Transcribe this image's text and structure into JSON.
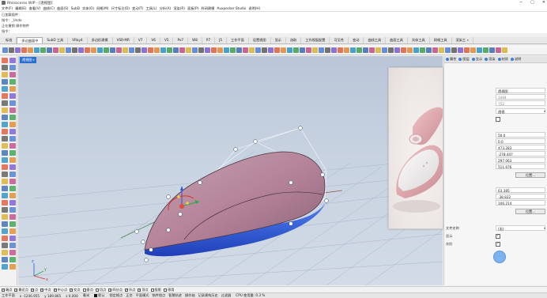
{
  "window": {
    "title": "Rhinoceros WIP - [透视图]",
    "min_label": "−",
    "max_label": "▢",
    "close_label": "✕"
  },
  "menu": [
    "文件(F)",
    "编辑(E)",
    "查看(V)",
    "曲线(C)",
    "曲面(S)",
    "SubD",
    "实体(O)",
    "网格(M)",
    "尺寸标注(D)",
    "变动(T)",
    "工具(L)",
    "分析(A)",
    "渲染(R)",
    "面板(P)",
    "科研建模",
    "Auxpecker Studio",
    "说明(H)"
  ],
  "command_history": [
    "已加载插件：",
    "指令：_Undo",
    "正在撤销 操作物件",
    "指令："
  ],
  "tabs": [
    {
      "label": "标准",
      "active": false
    },
    {
      "label": "多边曲面中",
      "active": true
    },
    {
      "label": "SubD 工具",
      "active": false
    },
    {
      "label": "VRay4",
      "active": false
    },
    {
      "label": "多边形建模",
      "active": false
    },
    {
      "label": "VSR-MR",
      "active": false
    },
    {
      "label": "V7",
      "active": false
    },
    {
      "label": "V6",
      "active": false
    },
    {
      "label": "V5",
      "active": false
    },
    {
      "label": "Pe7",
      "active": false
    },
    {
      "label": "W8",
      "active": false
    },
    {
      "label": "P7",
      "active": false
    },
    {
      "label": "J5",
      "active": false
    },
    {
      "label": "工作平面",
      "active": false
    },
    {
      "label": "设置视图",
      "active": false
    },
    {
      "label": "显示",
      "active": false
    },
    {
      "label": "选取",
      "active": false
    },
    {
      "label": "工作视窗配置",
      "active": false
    },
    {
      "label": "可见性",
      "active": false
    },
    {
      "label": "变动",
      "active": false
    },
    {
      "label": "曲线工具",
      "active": false
    },
    {
      "label": "曲面工具",
      "active": false
    },
    {
      "label": "实体工具",
      "active": false
    },
    {
      "label": "网格工具",
      "active": false
    },
    {
      "label": "渲染工 »",
      "active": false
    }
  ],
  "viewport": {
    "label": "透视图"
  },
  "colors": {
    "model_body": "#b9889a",
    "model_underside": "#3d6fe0",
    "selection_yellow": "#e8d640",
    "accent_blue": "#2b6fd1"
  },
  "right_panel": {
    "tabs": [
      "属性",
      "图层",
      "显示",
      "渲染",
      "材质",
      "说明"
    ],
    "rows": [
      {
        "label": "",
        "value": "透视图",
        "kind": "field"
      },
      {
        "label": "",
        "value": "1494",
        "kind": "field_grey"
      },
      {
        "label": "",
        "value": "752",
        "kind": "field_grey"
      },
      {
        "label": "",
        "value": "透视",
        "kind": "dropdown"
      },
      {
        "label": "",
        "value": "",
        "kind": "check"
      },
      {
        "label": "",
        "value": "50.0",
        "kind": "field"
      },
      {
        "label": "",
        "value": "0.0",
        "kind": "field"
      },
      {
        "label": "",
        "value": "473.283",
        "kind": "field"
      },
      {
        "label": "",
        "value": "-278.447",
        "kind": "field"
      },
      {
        "label": "",
        "value": "297.063",
        "kind": "field"
      },
      {
        "label": "",
        "value": "511.676",
        "kind": "field"
      },
      {
        "label": "",
        "value": "位置...",
        "kind": "button"
      },
      {
        "label": "",
        "value": "63.385",
        "kind": "field"
      },
      {
        "label": "",
        "value": "-38.822",
        "kind": "field"
      },
      {
        "label": "",
        "value": "106.214",
        "kind": "field"
      },
      {
        "label": "",
        "value": "位置...",
        "kind": "button"
      },
      {
        "label": "文件名称",
        "value": "(无)",
        "kind": "dropdown"
      },
      {
        "label": "显示",
        "value": "✓",
        "kind": "check"
      },
      {
        "label": "灰阶",
        "value": "✓",
        "kind": "check"
      }
    ]
  },
  "osnap": [
    {
      "label": "端点",
      "checked": true
    },
    {
      "label": "最近点",
      "checked": true
    },
    {
      "label": "点",
      "checked": true
    },
    {
      "label": "中点",
      "checked": true
    },
    {
      "label": "中心点",
      "checked": true
    },
    {
      "label": "交点",
      "checked": true
    },
    {
      "label": "垂点",
      "checked": false
    },
    {
      "label": "切点",
      "checked": false
    },
    {
      "label": "四分点",
      "checked": true
    },
    {
      "label": "节点",
      "checked": true
    },
    {
      "label": "顶点",
      "checked": true
    },
    {
      "label": "投影",
      "checked": false
    },
    {
      "label": "停用",
      "checked": false
    }
  ],
  "status": {
    "plane": "工作平面",
    "x": "x -1246.955",
    "y": "y 189.865",
    "z": "z 0.000",
    "unit": "毫米",
    "layer": "默认",
    "buttons": [
      "锁定格点",
      "正交",
      "平面模式",
      "物件锁点",
      "智慧轨迹",
      "操作轴",
      "记录建构历史",
      "过滤器"
    ],
    "cpu": "CPU 使用量: 0.3 %"
  }
}
